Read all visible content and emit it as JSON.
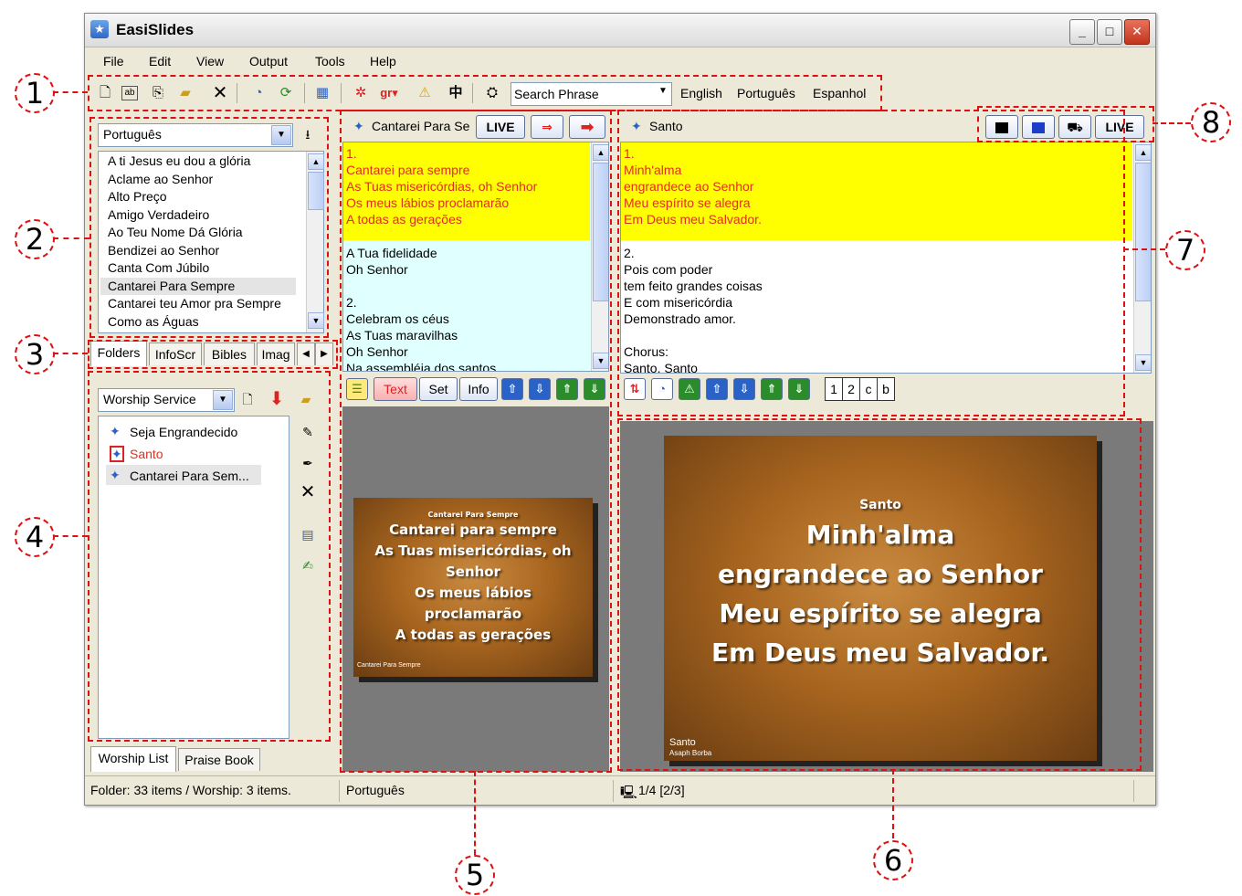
{
  "window": {
    "title": "EasiSlides"
  },
  "menu": [
    "File",
    "Edit",
    "View",
    "Output",
    "Tools",
    "Help"
  ],
  "toolbar": {
    "search_value": "Search Phrase",
    "lang_links": [
      "English",
      "Português",
      "Espanhol"
    ]
  },
  "folder_combo": "Português",
  "song_list": [
    "A ti Jesus eu dou a glória",
    "Aclame ao Senhor",
    "Alto Preço",
    "Amigo Verdadeiro",
    "Ao Teu Nome Dá Glória",
    "Bendizei ao Senhor",
    "Canta Com Júbilo",
    "Cantarei Para Sempre",
    "Cantarei teu Amor pra Sempre",
    "Como as Águas"
  ],
  "song_list_selected": 7,
  "left_tabs": [
    "Folders",
    "InfoScr",
    "Bibles",
    "Imag"
  ],
  "worship_combo": "Worship Service",
  "worship_items": [
    "Seja Engrandecido",
    "Santo",
    "Cantarei Para Sem..."
  ],
  "bottom_tabs": [
    "Worship List",
    "Praise Book"
  ],
  "preview": {
    "title": "Cantarei Para Se",
    "live_label": "LIVE",
    "lyrics_highlight": [
      "1.",
      "Cantarei para sempre",
      "As Tuas misericórdias, oh Senhor",
      "Os meus lábios proclamarão",
      "A todas as gerações"
    ],
    "lyrics_rest": [
      "A Tua fidelidade",
      "Oh Senhor",
      "",
      "2.",
      "Celebram os céus",
      "As Tuas maravilhas",
      "Oh Senhor",
      "Na assembléia dos santos"
    ],
    "buttons": [
      "Text",
      "Set",
      "Info"
    ],
    "slide_heading": "Cantarei Para Sempre",
    "slide_lines": [
      "Cantarei para sempre",
      "As Tuas misericórdias, oh",
      "Senhor",
      "Os meus lábios",
      "proclamarão",
      "A todas as gerações"
    ],
    "slide_footer": "Cantarei Para Sempre"
  },
  "output": {
    "title": "Santo",
    "live_label": "LIVE",
    "lyrics_highlight": [
      "1.",
      "Minh'alma",
      "engrandece ao Senhor",
      "Meu espírito se alegra",
      "Em Deus meu Salvador."
    ],
    "lyrics_rest": [
      "2.",
      "Pois com poder",
      "tem feito grandes coisas",
      "E com misericórdia",
      "Demonstrado amor.",
      "",
      "Chorus:",
      "Santo,     Santo"
    ],
    "num_buttons": [
      "1",
      "2",
      "c",
      "b"
    ],
    "slide_heading": "Santo",
    "slide_lines": [
      "Minh'alma",
      "engrandece ao Senhor",
      "Meu espírito se alegra",
      "Em Deus meu Salvador."
    ],
    "slide_footer": "Santo",
    "slide_footer2": "Asaph Borba"
  },
  "status": {
    "left": "Folder: 33 items / Worship: 3 items.",
    "middle": "Português",
    "right": "1/4 [2/3]"
  },
  "callouts": [
    "1",
    "2",
    "3",
    "4",
    "5",
    "6",
    "7",
    "8"
  ],
  "colors": {
    "highlight": "#ffff00",
    "preview_bg": "#e0ffff",
    "lyric_red": "#e0301e",
    "annotation": "#dd1111"
  }
}
